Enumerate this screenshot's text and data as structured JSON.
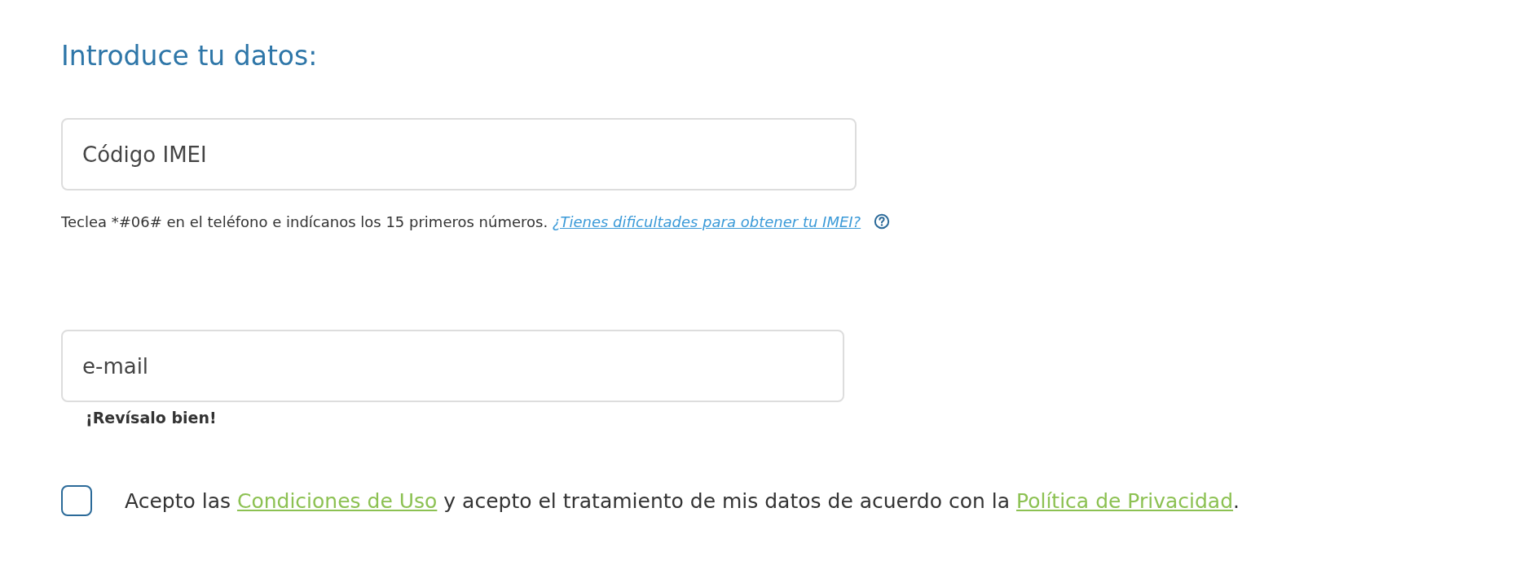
{
  "heading": "Introduce tu datos:",
  "imei_field": {
    "placeholder": "Código IMEI"
  },
  "imei_hint": {
    "text": "Teclea *#06# en el teléfono e indícanos los 15 primeros números.",
    "link": "¿Tienes dificultades para obtener tu IMEI?"
  },
  "email_field": {
    "placeholder": "e-mail"
  },
  "email_hint": "¡Revísalo bien!",
  "consent": {
    "checked": false,
    "parts": [
      {
        "kind": "text",
        "text": "Acepto las "
      },
      {
        "kind": "link",
        "text": "Condiciones de Uso"
      },
      {
        "kind": "text",
        "text": " y acepto el tratamiento de mis datos de acuerdo con la "
      },
      {
        "kind": "link",
        "text": "Política de Privacidad"
      },
      {
        "kind": "text",
        "text": "."
      }
    ]
  }
}
